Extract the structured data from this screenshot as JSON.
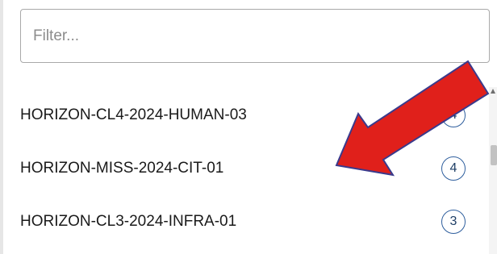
{
  "filter": {
    "placeholder": "Filter...",
    "value": ""
  },
  "list": {
    "items": [
      {
        "label": "HORIZON-CL4-2024-HUMAN-03",
        "count": "4"
      },
      {
        "label": "HORIZON-MISS-2024-CIT-01",
        "count": "4"
      },
      {
        "label": "HORIZON-CL3-2024-INFRA-01",
        "count": "3"
      }
    ]
  },
  "annotation": {
    "icon": "red-arrow-icon",
    "color": "#e0201b",
    "outline_color": "#3a3a8c"
  }
}
